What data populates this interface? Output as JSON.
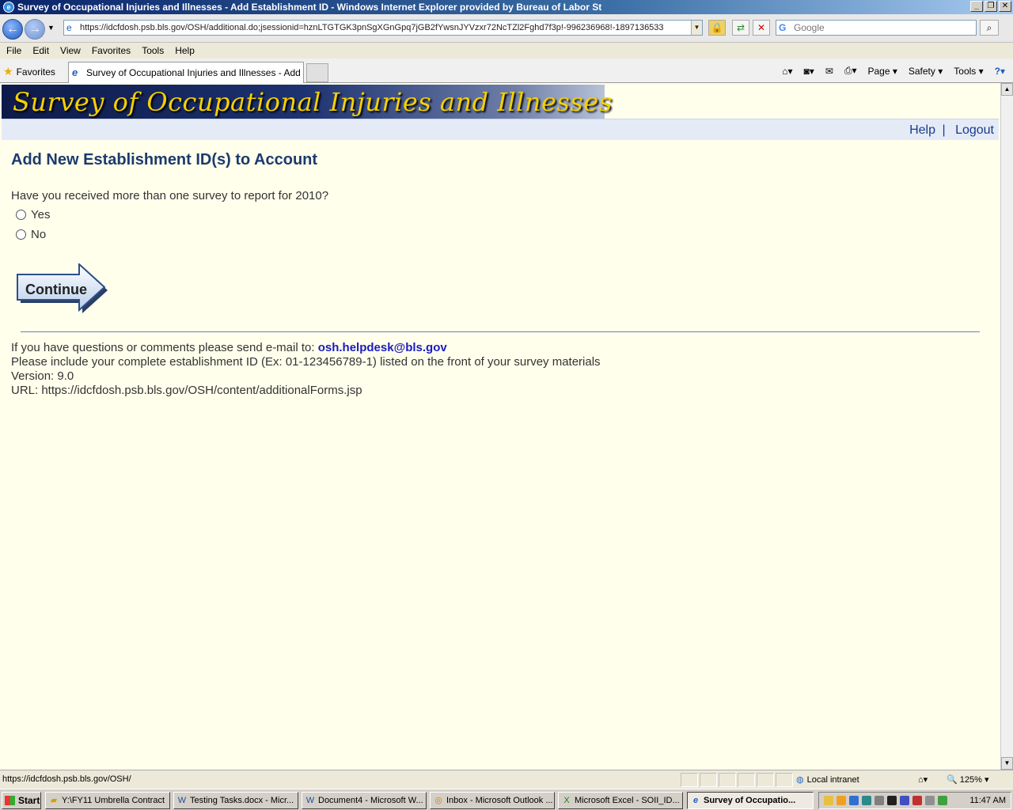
{
  "window": {
    "title": "Survey of Occupational Injuries and Illnesses - Add Establishment ID - Windows Internet Explorer provided by Bureau of Labor St"
  },
  "browser": {
    "url": "https://idcfdosh.psb.bls.gov/OSH/additional.do;jsessionid=hznLTGTGK3pnSgXGnGpq7jGB2fYwsnJYVzxr72NcTZl2Fghd7f3p!-996236968!-1897136533",
    "search_placeholder": "Google",
    "menu": [
      "File",
      "Edit",
      "View",
      "Favorites",
      "Tools",
      "Help"
    ],
    "favorites_label": "Favorites",
    "tab_title": "Survey of Occupational Injuries and Illnesses - Add Est...",
    "commands": [
      "Page",
      "Safety",
      "Tools"
    ]
  },
  "page": {
    "banner_title": "Survey of Occupational Injuries and Illnesses",
    "help_link": "Help",
    "separator": "|",
    "logout_link": "Logout",
    "heading": "Add New Establishment ID(s) to Account",
    "question": "Have you received more than one survey to report for 2010?",
    "options": [
      "Yes",
      "No"
    ],
    "continue_label": "Continue",
    "footer": {
      "contact_prefix": "If you have questions or comments please send e-mail to:",
      "email": "osh.helpdesk@bls.gov",
      "note": "Please include your complete establishment ID (Ex: 01-123456789-1) listed on the front of your survey materials",
      "version": "Version: 9.0",
      "url_line": "URL: https://idcfdosh.psb.bls.gov/OSH/content/additionalForms.jsp"
    }
  },
  "status": {
    "url": "https://idcfdosh.psb.bls.gov/OSH/",
    "zone": "Local intranet",
    "zoom": "125%"
  },
  "taskbar": {
    "start": "Start",
    "items": [
      "Y:\\FY11 Umbrella Contract",
      "Testing Tasks.docx - Micr...",
      "Document4 - Microsoft W...",
      "Inbox - Microsoft Outlook ...",
      "Microsoft Excel - SOII_ID...",
      "Survey of Occupatio..."
    ],
    "time": "11:47 AM"
  },
  "colors": {
    "page_bg": "#ffffec",
    "heading": "#1c3a6e",
    "banner_text": "#f5d000",
    "link": "#1a3b8c",
    "email": "#1a1ac0"
  }
}
